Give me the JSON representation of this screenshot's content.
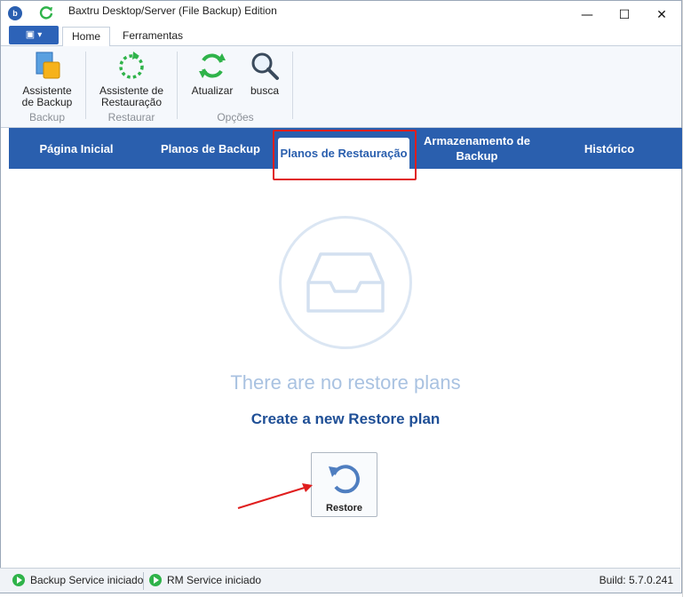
{
  "window": {
    "title": "Baxtru Desktop/Server (File Backup) Edition",
    "minimize": "—",
    "maximize": "☐",
    "close": "✕"
  },
  "app_menu": {
    "label": "▾"
  },
  "ribbon_tabs": [
    {
      "label": "Home",
      "active": true
    },
    {
      "label": "Ferramentas",
      "active": false
    }
  ],
  "ribbon": {
    "buttons": {
      "backup_wizard": "Assistente de Backup",
      "restore_wizard": "Assistente de Restauração",
      "refresh": "Atualizar",
      "search": "busca"
    },
    "groups": {
      "backup": "Backup",
      "restore": "Restaurar",
      "options": "Opções"
    }
  },
  "nav": {
    "items": [
      {
        "label": "Página Inicial"
      },
      {
        "label": "Planos de Backup"
      },
      {
        "label": "Planos de Restauração",
        "active": true
      },
      {
        "label": "Armazenamento de Backup"
      },
      {
        "label": "Histórico"
      }
    ]
  },
  "content": {
    "empty_message": "There are no restore plans",
    "create_link": "Create a new Restore plan",
    "restore_button": "Restore"
  },
  "status": {
    "backup_service": "Backup Service iniciado",
    "rm_service": "RM Service iniciado",
    "build": "Build: 5.7.0.241"
  },
  "colors": {
    "nav_blue": "#2a5fae",
    "highlight_red": "#e01e1e",
    "status_green": "#2fb34a",
    "link_blue": "#1f4f96"
  },
  "icons": {
    "backup": "backup-wizard-icon",
    "restore": "restore-wizard-icon",
    "refresh": "refresh-icon",
    "search": "search-icon",
    "inbox": "empty-inbox-icon",
    "restore_button": "restore-arrow-icon"
  }
}
